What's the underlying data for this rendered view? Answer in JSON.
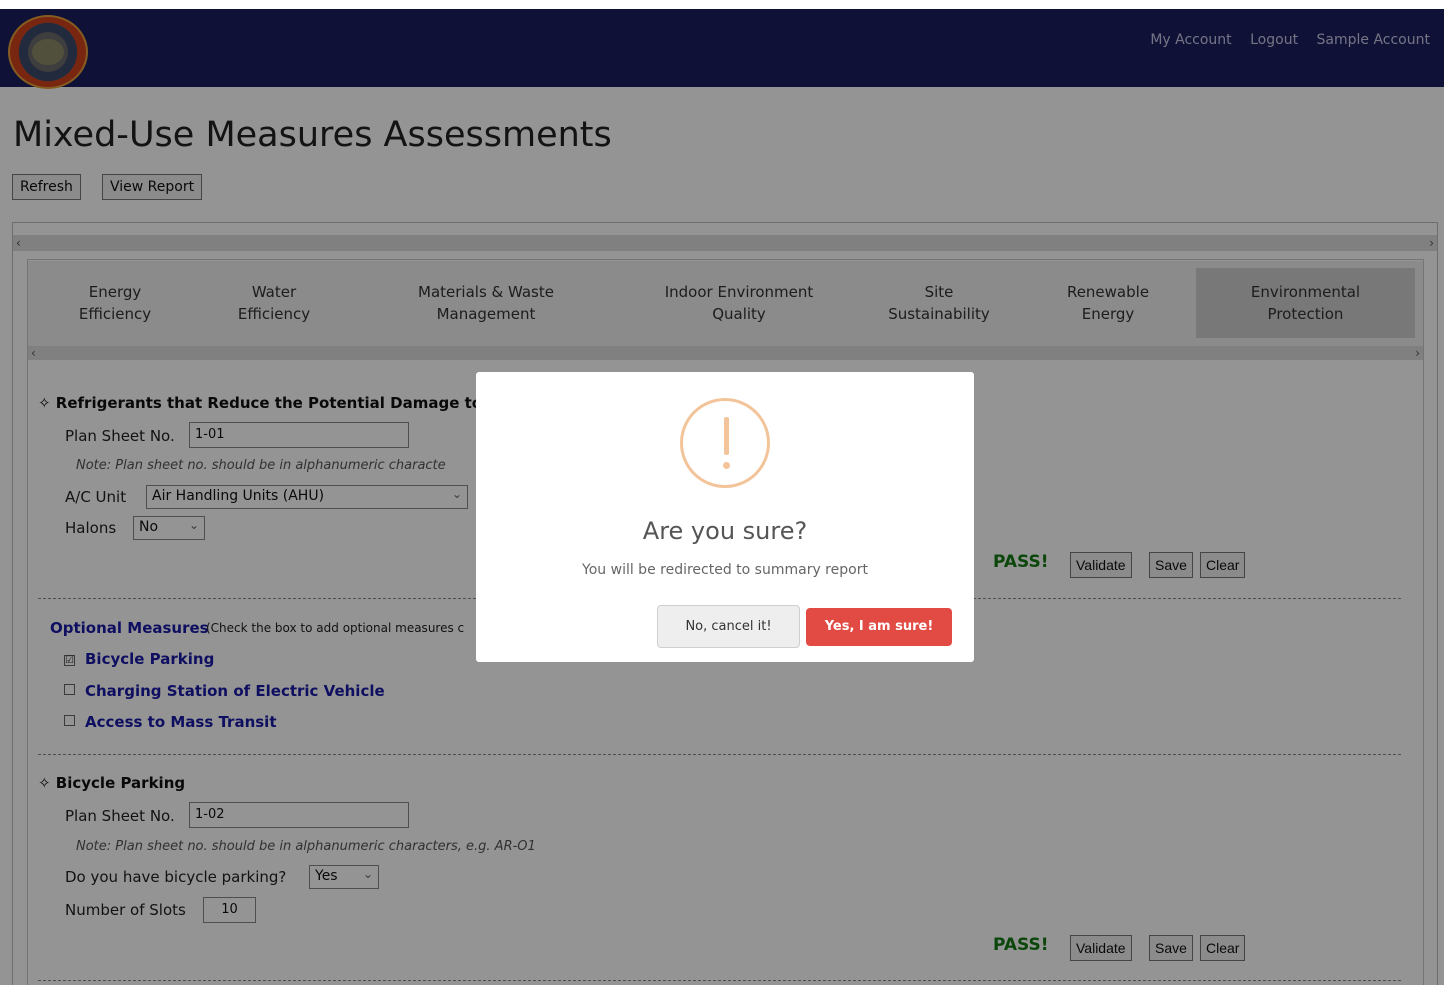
{
  "header": {
    "links": [
      "My Account",
      "Logout",
      "Sample Account"
    ]
  },
  "page": {
    "title": "Mixed-Use Measures Assessments",
    "refresh_label": "Refresh",
    "view_report_label": "View Report"
  },
  "tabs": [
    {
      "line1": "Energy",
      "line2": "Efficiency",
      "active": false
    },
    {
      "line1": "Water",
      "line2": "Efficiency",
      "active": false
    },
    {
      "line1": "Materials & Waste",
      "line2": "Management",
      "active": false
    },
    {
      "line1": "Indoor Environment",
      "line2": "Quality",
      "active": false
    },
    {
      "line1": "Site",
      "line2": "Sustainability",
      "active": false
    },
    {
      "line1": "Renewable",
      "line2": "Energy",
      "active": false
    },
    {
      "line1": "Environmental",
      "line2": "Protection",
      "active": true
    }
  ],
  "refrigerants": {
    "title": "✧ Refrigerants that Reduce the Potential Damage to",
    "plan_sheet_label": "Plan Sheet No.",
    "plan_sheet_value": "1-01",
    "note": "Note: Plan sheet no. should be in alphanumeric characte",
    "ac_label": "A/C Unit",
    "ac_value": "Air Handling Units (AHU)",
    "halons_label": "Halons",
    "halons_value": "No",
    "status": "PASS!",
    "validate_label": "Validate",
    "save_label": "Save",
    "clear_label": "Clear"
  },
  "optional": {
    "title": "Optional Measures",
    "subtitle": "(Check the box to add optional measures c",
    "items": [
      {
        "label": "Bicycle Parking",
        "checked": true,
        "mark": "☑"
      },
      {
        "label": "Charging Station of Electric Vehicle",
        "checked": false,
        "mark": ""
      },
      {
        "label": "Access to Mass Transit",
        "checked": false,
        "mark": ""
      }
    ]
  },
  "bicycle": {
    "title": "✧ Bicycle Parking",
    "plan_sheet_label": "Plan Sheet No.",
    "plan_sheet_value": "1-02",
    "note": "Note: Plan sheet no. should be in alphanumeric characters, e.g. AR-O1",
    "have_label": "Do you have bicycle parking?",
    "have_value": "Yes",
    "slots_label": "Number of Slots",
    "slots_value": "10",
    "status": "PASS!",
    "validate_label": "Validate",
    "save_label": "Save",
    "clear_label": "Clear"
  },
  "modal": {
    "title": "Are you sure?",
    "text": "You will be redirected to summary report",
    "cancel_label": "No, cancel it!",
    "confirm_label": "Yes, I am sure!"
  },
  "colors": {
    "header_bg": "#1c1e5e",
    "pass": "#137a13",
    "link_blue": "#1a1aa8",
    "confirm": "#e24b44",
    "warning": "#f3c49a"
  }
}
